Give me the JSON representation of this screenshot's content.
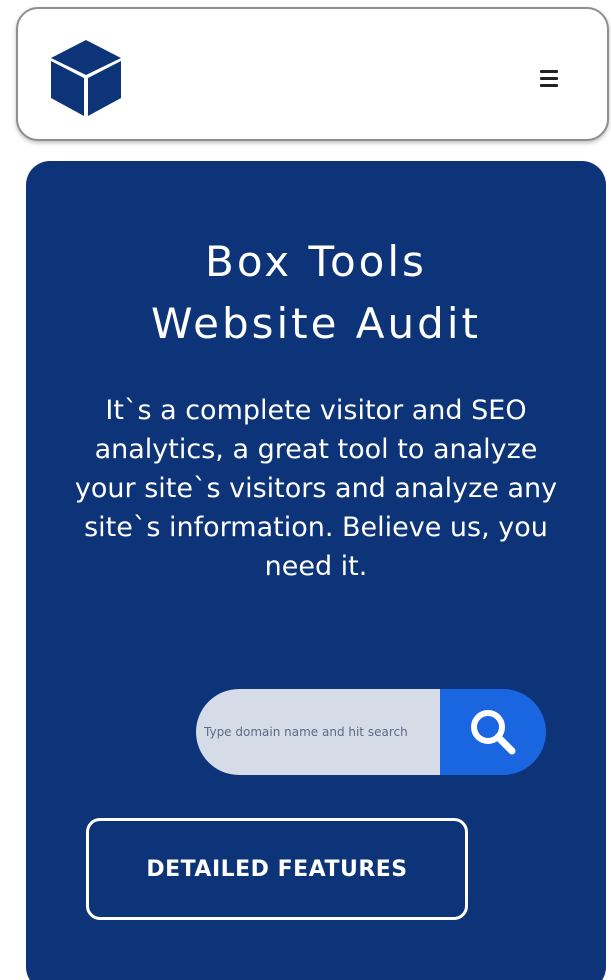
{
  "header": {
    "logo_icon": "cube-icon",
    "menu_icon": "hamburger-menu-icon"
  },
  "hero": {
    "title_line1": "Box Tools",
    "title_line2": "Website Audit",
    "description": "It`s a complete visitor and SEO analytics, a great tool to analyze your site`s visitors and analyze any site`s information. Believe us, you need it.",
    "search": {
      "placeholder": "Type domain name and hit search",
      "value": "",
      "button_icon": "search-icon"
    },
    "cta_label": "DETAILED FEATURES"
  },
  "colors": {
    "brand_navy": "#0d3478",
    "search_button": "#1a66e0",
    "input_background": "#d6dbe8"
  }
}
